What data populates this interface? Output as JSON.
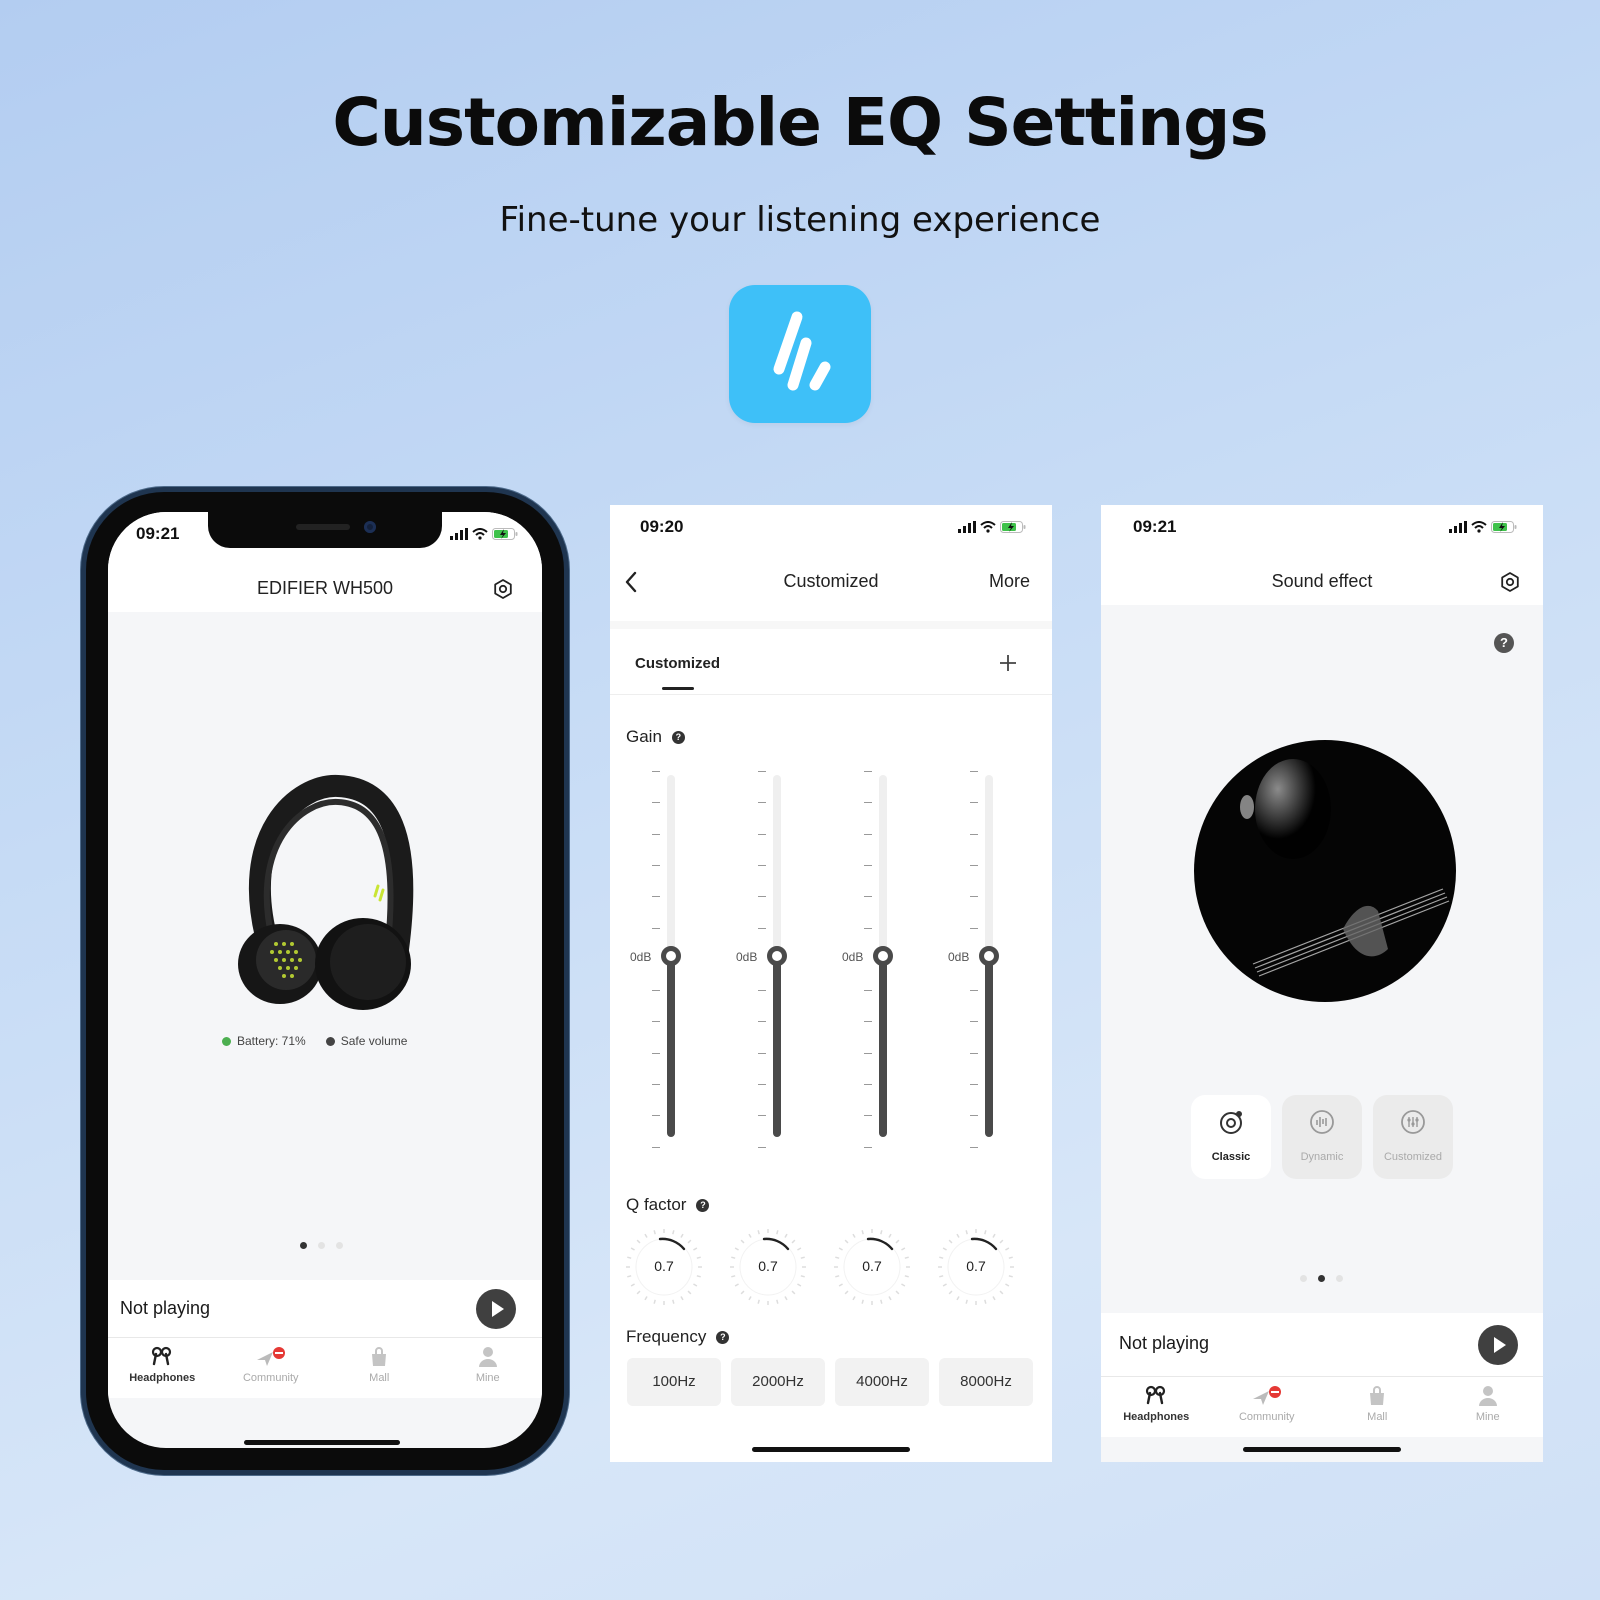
{
  "hero": {
    "title": "Customizable EQ Settings",
    "subtitle": "Fine-tune your listening experience",
    "app_icon": "edifier-connect-logo-icon",
    "app_icon_color": "#3EC0F8"
  },
  "phone1": {
    "status": {
      "time": "09:21",
      "icons": [
        "signal-icon",
        "wifi-icon",
        "battery-charging-icon"
      ]
    },
    "nav": {
      "title": "EDIFIER WH500",
      "right_icon": "settings-icon"
    },
    "device_image": "black-on-ear-headphones",
    "battery": {
      "label": "Battery: 71%",
      "color": "#4CAF50"
    },
    "safe_volume": {
      "label": "Safe volume",
      "color": "#444444"
    },
    "pager": {
      "count": 3,
      "active": 0
    },
    "player": {
      "text": "Not playing",
      "button_icon": "play-icon"
    },
    "tabs": [
      {
        "label": "Headphones",
        "icon": "earbuds-icon",
        "active": true
      },
      {
        "label": "Community",
        "icon": "community-icon",
        "active": false,
        "badge": true
      },
      {
        "label": "Mall",
        "icon": "shopping-bag-icon",
        "active": false
      },
      {
        "label": "Mine",
        "icon": "person-icon",
        "active": false
      }
    ]
  },
  "phone2": {
    "status": {
      "time": "09:20"
    },
    "nav": {
      "back_icon": "back-chevron-icon",
      "title": "Customized",
      "right_label": "More"
    },
    "preset_tab": {
      "label": "Customized",
      "add_icon": "plus-icon"
    },
    "gain": {
      "label": "Gain",
      "bands": [
        {
          "label": "0dB",
          "value_db": 0
        },
        {
          "label": "0dB",
          "value_db": 0
        },
        {
          "label": "0dB",
          "value_db": 0
        },
        {
          "label": "0dB",
          "value_db": 0
        }
      ]
    },
    "q_factor": {
      "label": "Q factor",
      "values": [
        "0.7",
        "0.7",
        "0.7",
        "0.7"
      ]
    },
    "frequency": {
      "label": "Frequency",
      "values": [
        "100Hz",
        "2000Hz",
        "4000Hz",
        "8000Hz"
      ]
    }
  },
  "phone3": {
    "status": {
      "time": "09:21"
    },
    "nav": {
      "title": "Sound effect",
      "right_icon": "settings-icon"
    },
    "help_icon": "help-icon",
    "artwork": "guitarist-black-and-white-photo",
    "presets": [
      {
        "label": "Classic",
        "icon": "music-disc-icon",
        "active": true
      },
      {
        "label": "Dynamic",
        "icon": "waveform-icon",
        "active": false
      },
      {
        "label": "Customized",
        "icon": "equalizer-icon",
        "active": false
      }
    ],
    "pager": {
      "count": 3,
      "active": 1
    },
    "player": {
      "text": "Not playing"
    },
    "tabs": [
      {
        "label": "Headphones",
        "active": true
      },
      {
        "label": "Community",
        "active": false
      },
      {
        "label": "Mall",
        "active": false
      },
      {
        "label": "Mine",
        "active": false
      }
    ]
  }
}
